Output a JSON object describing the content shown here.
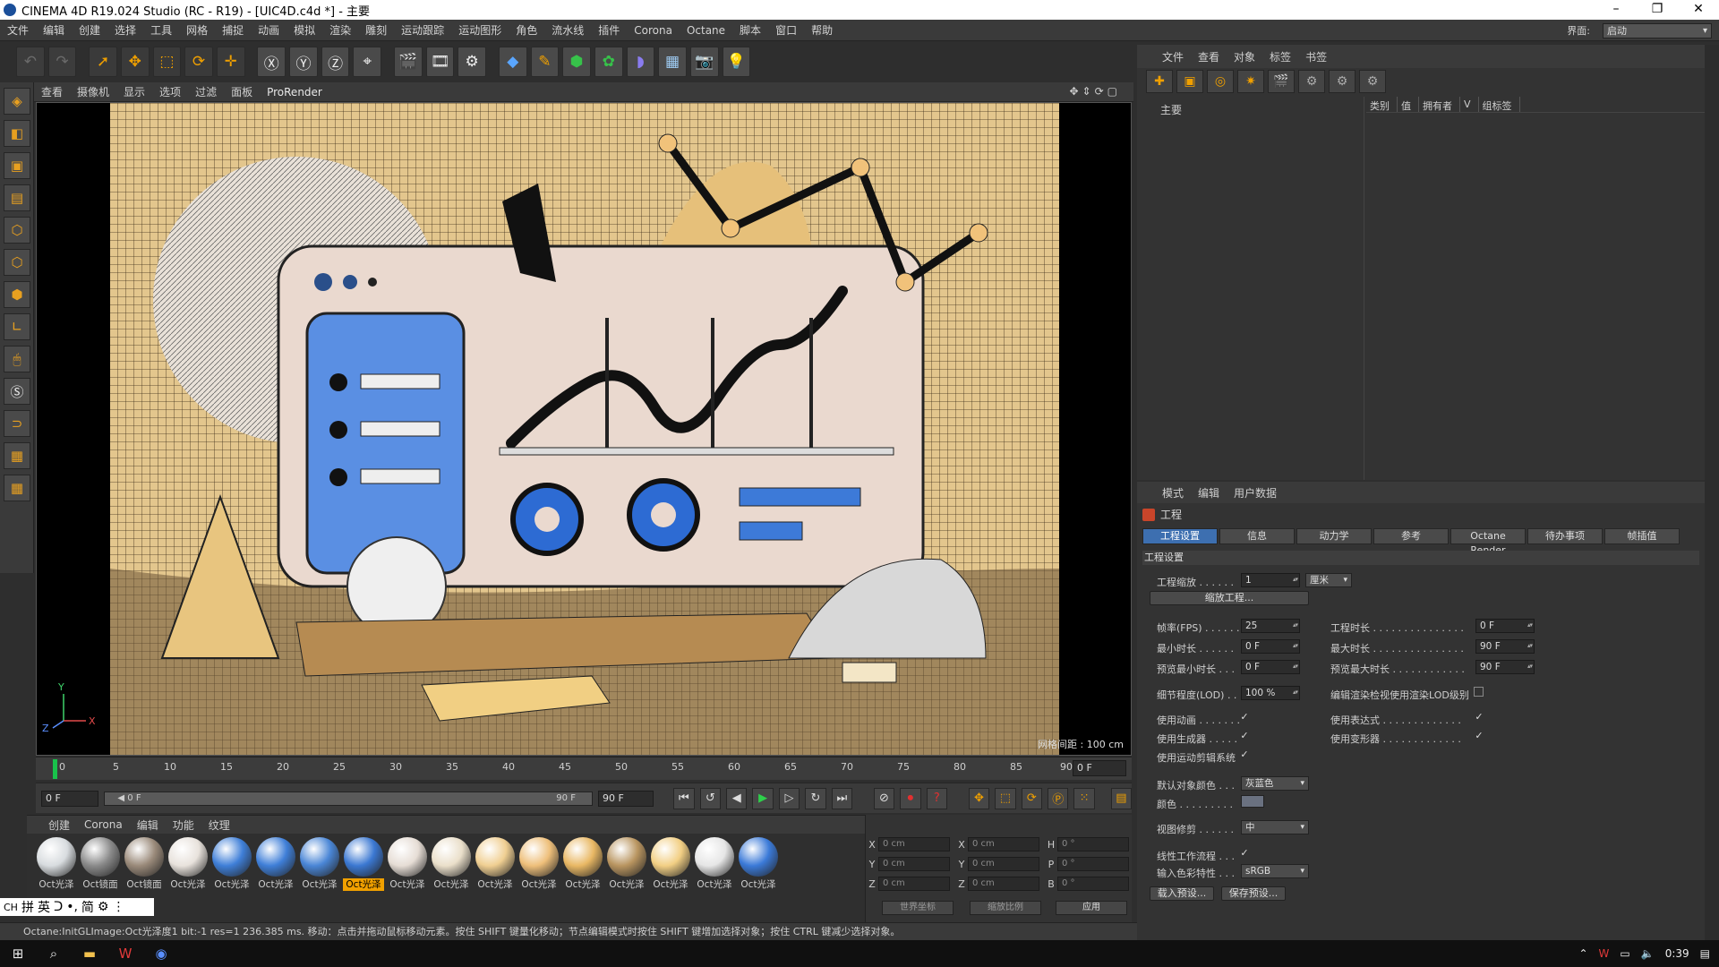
{
  "window": {
    "title": "CINEMA 4D R19.024 Studio (RC - R19) - [UIC4D.c4d *] - 主要",
    "min": "–",
    "max": "❐",
    "close": "✕"
  },
  "menu": [
    "文件",
    "编辑",
    "创建",
    "选择",
    "工具",
    "网格",
    "捕捉",
    "动画",
    "模拟",
    "渲染",
    "雕刻",
    "运动跟踪",
    "运动图形",
    "角色",
    "流水线",
    "插件",
    "Corona",
    "Octane",
    "脚本",
    "窗口",
    "帮助"
  ],
  "interface": {
    "label": "界面:",
    "value": "启动"
  },
  "viewport": {
    "menu": [
      "查看",
      "摄像机",
      "显示",
      "选项",
      "过滤",
      "面板"
    ],
    "prorender": "ProRender",
    "grid_label": "网格间距 : 100 cm",
    "axis": {
      "y": "Y",
      "z": "Z",
      "x": "X"
    }
  },
  "timeline": {
    "ticks": [
      "0",
      "5",
      "10",
      "15",
      "20",
      "25",
      "30",
      "35",
      "40",
      "45",
      "50",
      "55",
      "60",
      "65",
      "70",
      "75",
      "80",
      "85",
      "90"
    ],
    "current_frame": "0 F"
  },
  "transport": {
    "start": "0 F",
    "slider_start": "◀ 0 F",
    "slider_end": "90 F",
    "end": "90 F"
  },
  "materials": {
    "menu": [
      "创建",
      "Corona",
      "编辑",
      "功能",
      "纹理"
    ],
    "items": [
      {
        "label": "Oct光泽",
        "color": "#d8dcdf"
      },
      {
        "label": "Oct镜面",
        "color": "#8a8a8a"
      },
      {
        "label": "Oct镜面",
        "color": "#9a8a7a"
      },
      {
        "label": "Oct光泽",
        "color": "#e8e2dc"
      },
      {
        "label": "Oct光泽",
        "color": "#3f7fd8"
      },
      {
        "label": "Oct光泽",
        "color": "#3f7fd8"
      },
      {
        "label": "Oct光泽",
        "color": "#4a86d6"
      },
      {
        "label": "Oct光泽",
        "color": "#3b78d2"
      },
      {
        "label": "Oct光泽",
        "color": "#e6ddd5"
      },
      {
        "label": "Oct光泽",
        "color": "#eadfca"
      },
      {
        "label": "Oct光泽",
        "color": "#f0cf92"
      },
      {
        "label": "Oct光泽",
        "color": "#eebf7a"
      },
      {
        "label": "Oct光泽",
        "color": "#e9b864"
      },
      {
        "label": "Oct光泽",
        "color": "#b99560"
      },
      {
        "label": "Oct光泽",
        "color": "#f2cf84"
      },
      {
        "label": "Oct光泽",
        "color": "#e6e6e6"
      },
      {
        "label": "Oct光泽",
        "color": "#3b7ad8"
      }
    ],
    "selected_index": 7
  },
  "coords": {
    "x": {
      "label": "X",
      "pos": "0 cm",
      "size_label": "X",
      "size": "0 cm",
      "rot_label": "H",
      "rot": "0 °"
    },
    "y": {
      "label": "Y",
      "pos": "0 cm",
      "size_label": "Y",
      "size": "0 cm",
      "rot_label": "P",
      "rot": "0 °"
    },
    "z": {
      "label": "Z",
      "pos": "0 cm",
      "size_label": "Z",
      "size": "0 cm",
      "rot_label": "B",
      "rot": "0 °"
    },
    "world": "世界坐标",
    "scale": "缩放比例",
    "apply": "应用"
  },
  "ime": {
    "items": [
      "CH",
      "拼",
      "英",
      "ᑐ",
      "•,",
      "简",
      "⚙",
      "⋮"
    ]
  },
  "status": "Octane:InitGLImage:Oct光泽度1  bit:-1 res=1  236.385 ms.      移动：点击并拖动鼠标移动元素。按住 SHIFT 键量化移动；节点编辑模式时按住 SHIFT 键增加选择对象；按住 CTRL 键减少选择对象。",
  "objects": {
    "menu": [
      "文件",
      "查看",
      "对象",
      "标签",
      "书签"
    ],
    "tree_item": "主要",
    "columns": [
      "类别",
      "值",
      "拥有者",
      "V",
      "组标签"
    ]
  },
  "attributes": {
    "menu": [
      "模式",
      "编辑",
      "用户数据"
    ],
    "title": "工程",
    "tabs": [
      "工程设置",
      "信息",
      "动力学",
      "参考",
      "Octane Render",
      "待办事项",
      "帧插值"
    ],
    "section": "工程设置",
    "scale_label": "工程缩放 . . . . . .",
    "scale_value": "1",
    "scale_unit": "厘米",
    "scale_button": "缩放工程...",
    "fps_label": "帧率(FPS) . . . . . .",
    "fps_value": "25",
    "duration_label": "工程时长 . . . . . . . . . . . . . . .",
    "duration_value": "0 F",
    "min_label": "最小时长 . . . . . .",
    "min_value": "0 F",
    "max_label": "最大时长 . . . . . . . . . . . . . . .",
    "max_value": "90 F",
    "pmin_label": "预览最小时长 . . .",
    "pmin_value": "0 F",
    "pmax_label": "预览最大时长 . . . . . . . . . . . .",
    "pmax_value": "90 F",
    "lod_label": "细节程度(LOD) . .",
    "lod_value": "100 %",
    "lod_render_label": "编辑渲染检视使用渲染LOD级别",
    "anim_label": "使用动画 . . . . . . .",
    "expr_label": "使用表达式 . . . . . . . . . . . . .",
    "gen_label": "使用生成器 . . . . .",
    "deform_label": "使用变形器 . . . . . . . . . . . . .",
    "mograph_label": "使用运动剪辑系统",
    "defcolor_label": "默认对象颜色 . . .",
    "defcolor_value": "灰蓝色",
    "color_label": "颜色 . . . . . . . . .",
    "clip_label": "视图修剪 . . . . . .",
    "clip_value": "中",
    "linear_label": "线性工作流程 . . .",
    "profile_label": "输入色彩特性 . . .",
    "profile_value": "sRGB",
    "load_preset": "载入预设...",
    "save_preset": "保存预设..."
  },
  "taskbar": {
    "time": "0:39"
  }
}
